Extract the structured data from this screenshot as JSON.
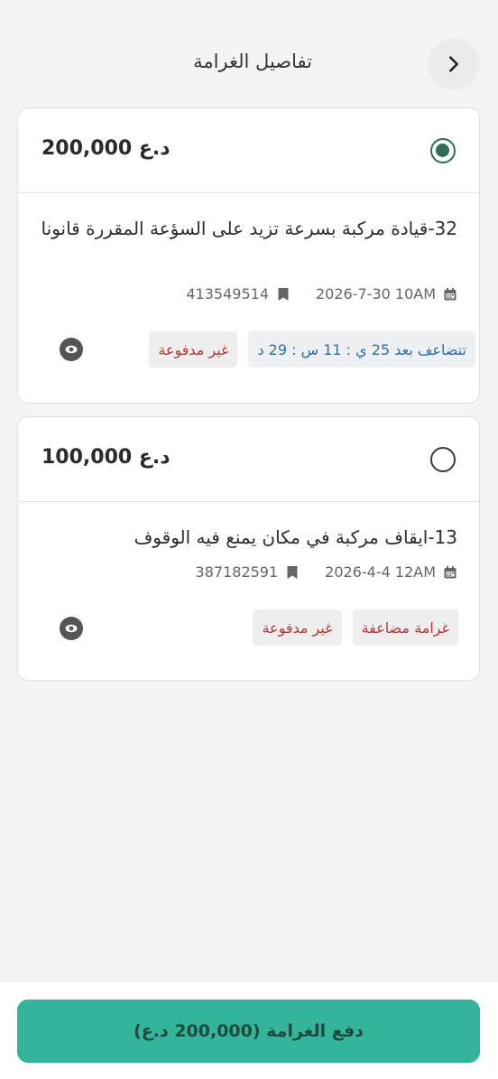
{
  "header": {
    "title": "تفاصيل الغرامة",
    "back_icon": "chevron-right-icon"
  },
  "fines": [
    {
      "amount": "200,000 د.ع",
      "selected": true,
      "description": "32-قيادة مركبة بسرعة تزيد على السؤعة المقررة قانونا",
      "date": "2026-7-30 10AM",
      "receipt_number": "413549514",
      "badges": [
        {
          "label": "غير مدفوعة",
          "color": "#b23b3b"
        },
        {
          "label": "تتضاعف بعد 25 ي : 11 س : 29 د",
          "color": "#2f6fa3"
        }
      ]
    },
    {
      "amount": "100,000 د.ع",
      "selected": false,
      "description": "13-ايقاف مركبة في مكان يمنع فيه الوقوف",
      "date": "2026-4-4 12AM",
      "receipt_number": "387182591",
      "badges": [
        {
          "label": "غير مدفوعة",
          "color": "#b23b3b"
        },
        {
          "label": "غرامة مضاعفة",
          "color": "#b23b3b"
        }
      ]
    }
  ],
  "footer": {
    "pay_label": "دفع الغرامة (200,000 د.ع)",
    "button_color": "#34b49a"
  }
}
